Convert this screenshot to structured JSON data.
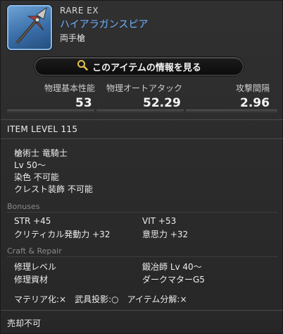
{
  "header": {
    "rarity": "RARE EX",
    "name": "ハイアラガンスピア",
    "type": "両手槍"
  },
  "info_button": {
    "label": "このアイテムの情報を見る"
  },
  "stats": [
    {
      "label": "物理基本性能",
      "value": "53"
    },
    {
      "label": "物理オートアタック",
      "value": "52.29"
    },
    {
      "label": "攻撃間隔",
      "value": "2.96"
    }
  ],
  "item_level": "ITEM LEVEL 115",
  "requirements": {
    "jobs": "槍術士 竜騎士",
    "level": "Lv 50～",
    "dye": "染色 不可能",
    "crest": "クレスト装飾 不可能"
  },
  "bonuses": {
    "heading": "Bonuses",
    "items": [
      "STR +45",
      "VIT +53",
      "クリティカル発動力 +32",
      "意思力 +32"
    ]
  },
  "craft": {
    "heading": "Craft & Repair",
    "repair_level_label": "修理レベル",
    "repair_level_value": "鍛冶師 Lv 40～",
    "materials_label": "修理資材",
    "materials_value": "ダークマターG5",
    "flags": "マテリア化:×　武具投影:○　アイテム分解:×"
  },
  "footer": {
    "sell": "売却不可"
  },
  "colors": {
    "name": "#6fb0ff",
    "section": "#8a8a8a"
  }
}
